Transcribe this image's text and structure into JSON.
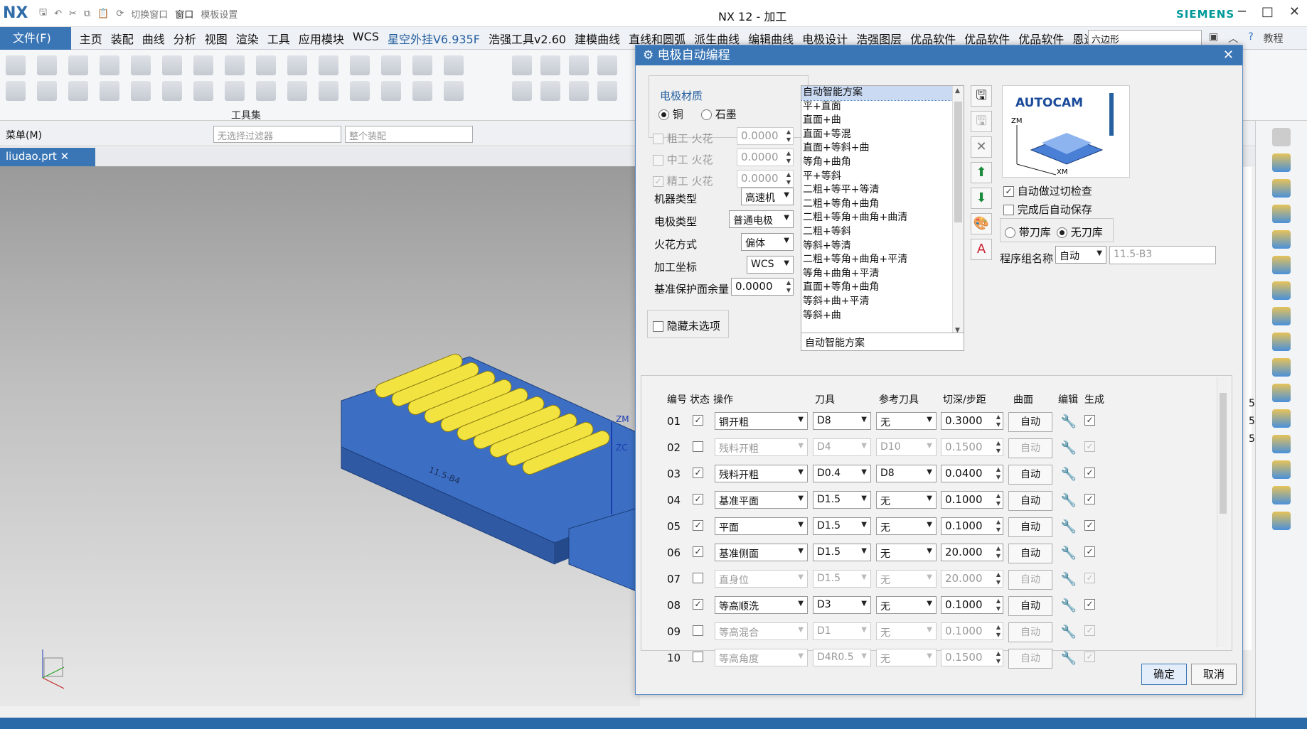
{
  "app": {
    "logo": "NX",
    "window_title": "NX 12 - 加工",
    "brand": "SIEMENS",
    "qat": [
      "切换窗口",
      "窗口",
      "模板设置"
    ]
  },
  "menubar": {
    "file": "文件(F)",
    "items": [
      "主页",
      "装配",
      "曲线",
      "分析",
      "视图",
      "渲染",
      "工具",
      "应用模块",
      "WCS",
      "星空外挂V6.935F",
      "浩强工具v2.60",
      "建模曲线",
      "直线和圆弧",
      "派生曲线",
      "编辑曲线",
      "电极设计",
      "浩强图层",
      "优品软件",
      "优品软件",
      "优品软件",
      "恩途外挂"
    ],
    "active_index": 9,
    "search_value": "六边形",
    "tutorial": "教程"
  },
  "toolbar": {
    "group_label": "工具集"
  },
  "filterbar": {
    "menu": "菜单(M)",
    "filter_placeholder": "无选择过滤器",
    "assembly_placeholder": "整个装配"
  },
  "tab": {
    "file_name": "liudao.prt"
  },
  "viewport": {
    "axis_zm": "ZM",
    "axis_zc": "ZC",
    "part_label": "11.5-B4"
  },
  "right_numbers": [
    "5",
    "5",
    "5"
  ],
  "dialog": {
    "title": "电极自动编程",
    "material": {
      "group_label": "电极材质",
      "options": [
        "铜",
        "石墨"
      ],
      "selected": "铜"
    },
    "sparks": [
      {
        "label": "粗工 火花",
        "value": "0.0000",
        "checked": false
      },
      {
        "label": "中工 火花",
        "value": "0.0000",
        "checked": false
      },
      {
        "label": "精工 火花",
        "value": "0.0000",
        "checked": true
      }
    ],
    "machine_type": {
      "label": "机器类型",
      "value": "高速机"
    },
    "electrode_type": {
      "label": "电极类型",
      "value": "普通电极"
    },
    "spark_mode": {
      "label": "火花方式",
      "value": "偏体"
    },
    "coordinate": {
      "label": "加工坐标",
      "value": "WCS"
    },
    "base_allowance": {
      "label": "基准保护面余量",
      "value": "0.0000"
    },
    "hide_unselected": "隐藏未选项",
    "schemes": [
      "自动智能方案",
      "平+直面",
      "直面+曲",
      "直面+等混",
      "直面+等斜+曲",
      "等角+曲角",
      "平+等斜",
      "二粗+等平+等清",
      "二粗+等角+曲角",
      "二粗+等角+曲角+曲清",
      "二粗+等斜",
      "等斜+等清",
      "二粗+等角+曲角+平清",
      "等角+曲角+平清",
      "直面+等角+曲角",
      "等斜+曲+平清",
      "等斜+曲"
    ],
    "scheme_selected": "自动智能方案",
    "scheme_current": "自动智能方案",
    "autocam": {
      "brand": "AUTOCAM",
      "zm": "ZM",
      "xm": "XM"
    },
    "auto_overcut_check": {
      "label": "自动做过切检查",
      "checked": true
    },
    "auto_save": {
      "label": "完成后自动保存",
      "checked": false
    },
    "tool_library": {
      "options": [
        "带刀库",
        "无刀库"
      ],
      "selected": "无刀库"
    },
    "program_group": {
      "label": "程序组名称",
      "mode": "自动",
      "value": "11.5-B3"
    },
    "table_headers": [
      "编号",
      "状态",
      "操作",
      "刀具",
      "参考刀具",
      "切深/步距",
      "曲面",
      "编辑",
      "生成"
    ],
    "rows": [
      {
        "no": "01",
        "on": true,
        "op": "铜开粗",
        "tool": "D8",
        "ref": "无",
        "depth": "0.3000",
        "surf": "自动",
        "gen": true
      },
      {
        "no": "02",
        "on": false,
        "op": "残料开粗",
        "tool": "D4",
        "ref": "D10",
        "depth": "0.1500",
        "surf": "自动",
        "gen": true
      },
      {
        "no": "03",
        "on": true,
        "op": "残料开粗",
        "tool": "D0.4",
        "ref": "D8",
        "depth": "0.0400",
        "surf": "自动",
        "gen": true
      },
      {
        "no": "04",
        "on": true,
        "op": "基准平面",
        "tool": "D1.5",
        "ref": "无",
        "depth": "0.1000",
        "surf": "自动",
        "gen": true
      },
      {
        "no": "05",
        "on": true,
        "op": "平面",
        "tool": "D1.5",
        "ref": "无",
        "depth": "0.1000",
        "surf": "自动",
        "gen": true
      },
      {
        "no": "06",
        "on": true,
        "op": "基准侧面",
        "tool": "D1.5",
        "ref": "无",
        "depth": "20.000",
        "surf": "自动",
        "gen": true
      },
      {
        "no": "07",
        "on": false,
        "op": "直身位",
        "tool": "D1.5",
        "ref": "无",
        "depth": "20.000",
        "surf": "自动",
        "gen": true
      },
      {
        "no": "08",
        "on": true,
        "op": "等高顺洗",
        "tool": "D3",
        "ref": "无",
        "depth": "0.1000",
        "surf": "自动",
        "gen": true
      },
      {
        "no": "09",
        "on": false,
        "op": "等高混合",
        "tool": "D1",
        "ref": "无",
        "depth": "0.1000",
        "surf": "自动",
        "gen": true
      },
      {
        "no": "10",
        "on": false,
        "op": "等高角度",
        "tool": "D4R0.5",
        "ref": "无",
        "depth": "0.1500",
        "surf": "自动",
        "gen": true
      }
    ],
    "ok": "确定",
    "cancel": "取消"
  }
}
